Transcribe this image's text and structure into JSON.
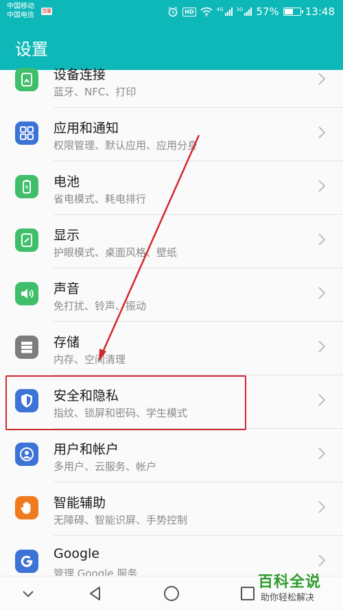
{
  "status_bar": {
    "carrier_1": "中国移动",
    "carrier_2": "中国电信",
    "sim_badge": "流量",
    "hd": "HD",
    "signal_tag_1": "4G",
    "signal_tag_2": "3G",
    "battery_percent": "57%",
    "battery_level": 0.57,
    "time": "13:48"
  },
  "app_bar": {
    "title": "设置"
  },
  "settings_items": [
    {
      "name": "device-connection",
      "title": "设备连接",
      "subtitle": "蓝牙、NFC、打印",
      "icon": "device-connection-icon",
      "color": "#3fbf6a"
    },
    {
      "name": "apps-notifications",
      "title": "应用和通知",
      "subtitle": "权限管理、默认应用、应用分身",
      "icon": "apps-grid-icon",
      "color": "#3d73d6"
    },
    {
      "name": "battery",
      "title": "电池",
      "subtitle": "省电模式、耗电排行",
      "icon": "battery-icon",
      "color": "#3fbf6a"
    },
    {
      "name": "display",
      "title": "显示",
      "subtitle": "护眼模式、桌面风格、壁纸",
      "icon": "display-icon",
      "color": "#3fbf6a"
    },
    {
      "name": "sound",
      "title": "声音",
      "subtitle": "免打扰、铃声、振动",
      "icon": "speaker-icon",
      "color": "#3fbf6a"
    },
    {
      "name": "storage",
      "title": "存储",
      "subtitle": "内存、空间清理",
      "icon": "storage-icon",
      "color": "#7d7d7d"
    },
    {
      "name": "security-privacy",
      "title": "安全和隐私",
      "subtitle": "指纹、锁屏和密码、学生模式",
      "icon": "shield-icon",
      "color": "#3d73d6"
    },
    {
      "name": "users-accounts",
      "title": "用户和帐户",
      "subtitle": "多用户、云服务、帐户",
      "icon": "user-icon",
      "color": "#3d73d6"
    },
    {
      "name": "smart-assist",
      "title": "智能辅助",
      "subtitle": "无障碍、智能识屏、手势控制",
      "icon": "hand-icon",
      "color": "#f07a1e"
    },
    {
      "name": "google",
      "title": "Google",
      "subtitle": "管理 Google 服务",
      "icon": "google-icon",
      "color": "#3d73d6"
    }
  ],
  "annotations": {
    "highlight_color": "#d0282e",
    "arrow_color": "#d0282e"
  },
  "nav_bar": {
    "buttons": [
      "collapse-icon",
      "back-icon",
      "home-icon",
      "recents-icon"
    ]
  },
  "watermark": {
    "title": "百科全说",
    "subtitle": "助你轻松解决"
  }
}
